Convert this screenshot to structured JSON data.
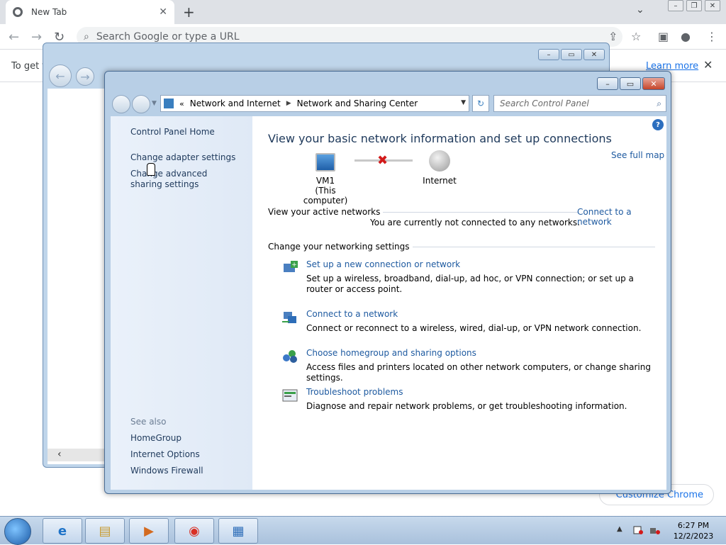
{
  "chrome": {
    "tab_title": "New Tab",
    "tab_close": "✕",
    "new_tab": "+",
    "omnibox_placeholder": "Search Google or type a URL",
    "infobar_message": "To get f",
    "infobar_link": "Learn more",
    "customize_label": "Customize Chrome"
  },
  "control_panel": {
    "breadcrumb": [
      "Network and Internet",
      "Network and Sharing Center"
    ],
    "search_placeholder": "Search Control Panel",
    "sidebar": {
      "links": [
        "Control Panel Home",
        "Change adapter settings",
        "Change advanced sharing settings"
      ],
      "see_also_label": "See also",
      "see_also": [
        "HomeGroup",
        "Internet Options",
        "Windows Firewall"
      ]
    },
    "main": {
      "heading": "View your basic network information and set up connections",
      "see_full_map": "See full map",
      "computer_name": "VM1",
      "computer_sub": "(This computer)",
      "internet_label": "Internet",
      "active_networks_label": "View your active networks",
      "connect_link": "Connect to a network",
      "not_connected": "You are currently not connected to any networks.",
      "change_settings_label": "Change your networking settings",
      "tasks": [
        {
          "title": "Set up a new connection or network",
          "desc": "Set up a wireless, broadband, dial-up, ad hoc, or VPN connection; or set up a router or access point.",
          "icon": "new-connection-icon"
        },
        {
          "title": "Connect to a network",
          "desc": "Connect or reconnect to a wireless, wired, dial-up, or VPN network connection.",
          "icon": "connect-network-icon"
        },
        {
          "title": "Choose homegroup and sharing options",
          "desc": "Access files and printers located on other network computers, or change sharing settings.",
          "icon": "homegroup-icon"
        },
        {
          "title": "Troubleshoot problems",
          "desc": "Diagnose and repair network problems, or get troubleshooting information.",
          "icon": "troubleshoot-icon"
        }
      ]
    }
  },
  "taskbar": {
    "time": "6:27 PM",
    "date": "12/2/2023"
  }
}
